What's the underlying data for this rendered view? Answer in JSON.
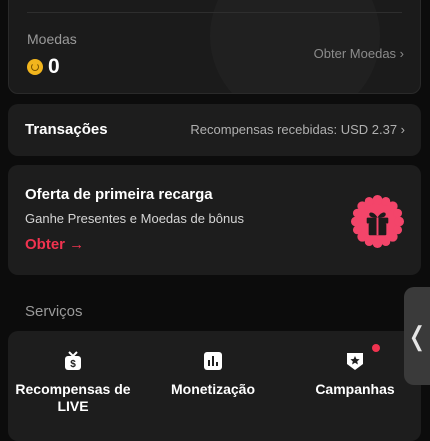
{
  "coins": {
    "label": "Moedas",
    "count": "0",
    "get_coins_label": "Obter Moedas ›"
  },
  "transactions": {
    "title": "Transações",
    "info": "Recompensas recebidas: USD 2.37  ›"
  },
  "offer": {
    "title": "Oferta de primeira recarga",
    "subtitle": "Ganhe Presentes e Moedas de bônus",
    "cta": "Obter →"
  },
  "services": {
    "title": "Serviços",
    "items": [
      {
        "label": "Recompensas de LIVE",
        "icon": "live-rewards-icon"
      },
      {
        "label": "Monetização",
        "icon": "bar-chart-icon"
      },
      {
        "label": "Campanhas",
        "icon": "campaign-badge-icon"
      }
    ]
  },
  "side_handle": {
    "glyph": "❬"
  },
  "colors": {
    "accent": "#f0334f",
    "coin": "#f2b51d",
    "card": "#1d1d1d",
    "background": "#0c0c0c"
  }
}
